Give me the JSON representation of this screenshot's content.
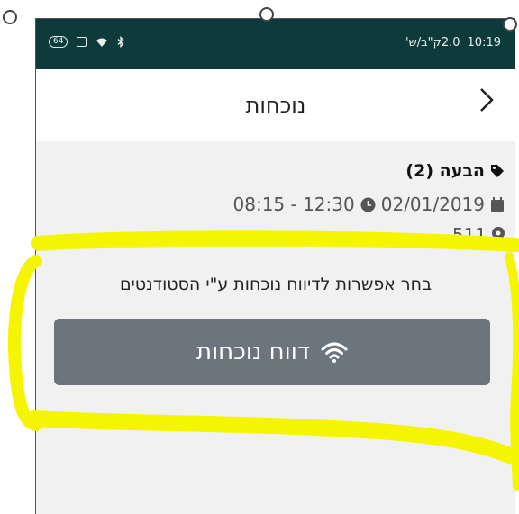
{
  "statusbar": {
    "time": "10:19",
    "speed": "2.0ק\"ב/ש'",
    "battery": "64",
    "wifi_icon": "wifi-icon",
    "bluetooth_icon": "bluetooth-icon"
  },
  "header": {
    "title": "נוכחות",
    "back_icon": "chevron-right-icon"
  },
  "lesson": {
    "name": "הבעה (2)",
    "date": "02/01/2019",
    "time_range": "12:30 - 08:15",
    "room": "511"
  },
  "prompt_text": "בחר אפשרות לדיווח נוכחות ע\"י הסטודנטים",
  "report_button": {
    "label": "דווח נוכחות",
    "icon": "wifi-icon",
    "color": "#6c757d"
  },
  "colors": {
    "statusbar": "#0f3a3c",
    "highlight": "#f5f500"
  }
}
